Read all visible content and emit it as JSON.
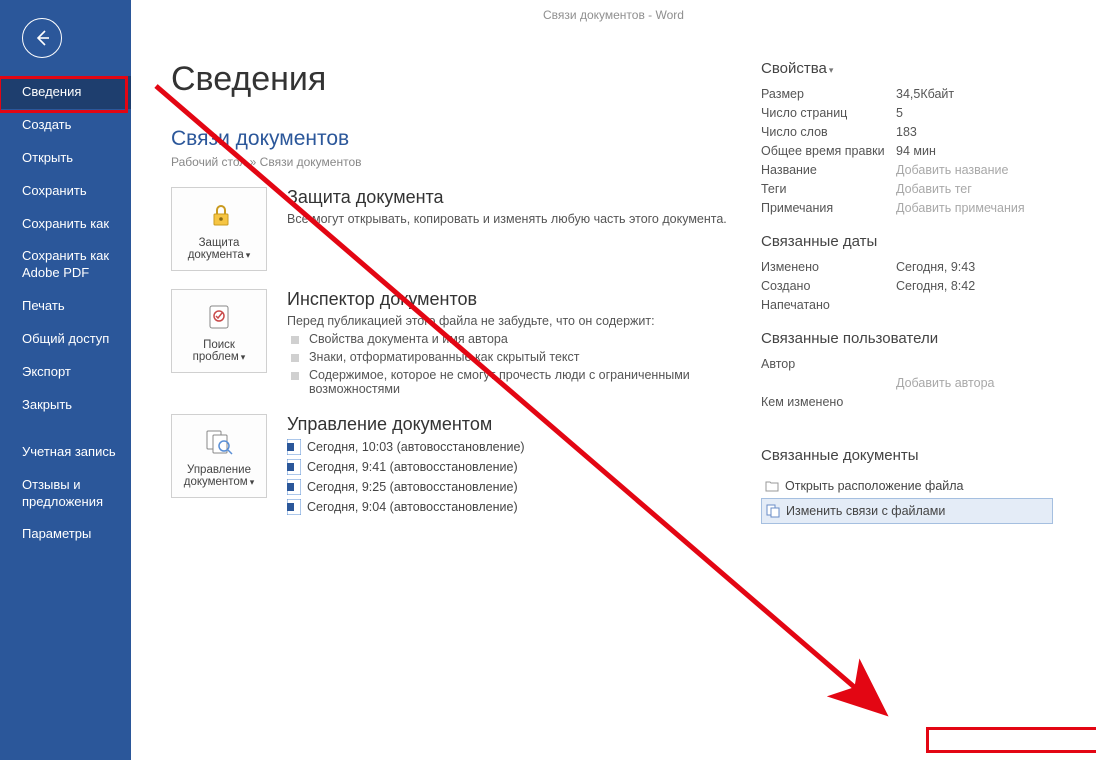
{
  "titlebar": "Связи документов  -  Word",
  "sidebar": {
    "items": [
      "Сведения",
      "Создать",
      "Открыть",
      "Сохранить",
      "Сохранить как",
      "Сохранить как Adobe PDF",
      "Печать",
      "Общий доступ",
      "Экспорт",
      "Закрыть",
      "Учетная запись",
      "Отзывы и предложения",
      "Параметры"
    ]
  },
  "page": {
    "title": "Сведения",
    "doc_title": "Связи документов",
    "breadcrumb": "Рабочий стол » Связи документов"
  },
  "protect": {
    "tile": "Защита документа",
    "heading": "Защита документа",
    "text": "Все могут открывать, копировать и изменять любую часть этого документа."
  },
  "inspect": {
    "tile": "Поиск проблем",
    "heading": "Инспектор документов",
    "intro": "Перед публикацией этого файла не забудьте, что он содержит:",
    "bullets": [
      "Свойства документа и имя автора",
      "Знаки, отформатированные как скрытый текст",
      "Содержимое, которое не смогут прочесть люди с ограниченными возможностями"
    ]
  },
  "manage": {
    "tile": "Управление документом",
    "heading": "Управление документом",
    "entries": [
      "Сегодня, 10:03 (автовосстановление)",
      "Сегодня, 9:41 (автовосстановление)",
      "Сегодня, 9:25 (автовосстановление)",
      "Сегодня, 9:04 (автовосстановление)"
    ]
  },
  "props": {
    "heading": "Свойства",
    "rows": [
      {
        "k": "Размер",
        "v": "34,5Кбайт"
      },
      {
        "k": "Число страниц",
        "v": "5"
      },
      {
        "k": "Число слов",
        "v": "183"
      },
      {
        "k": "Общее время правки",
        "v": "94 мин"
      },
      {
        "k": "Название",
        "v": "Добавить название",
        "muted": true
      },
      {
        "k": "Теги",
        "v": "Добавить тег",
        "muted": true
      },
      {
        "k": "Примечания",
        "v": "Добавить примечания",
        "muted": true
      }
    ]
  },
  "dates": {
    "heading": "Связанные даты",
    "rows": [
      {
        "k": "Изменено",
        "v": "Сегодня, 9:43"
      },
      {
        "k": "Создано",
        "v": "Сегодня, 8:42"
      },
      {
        "k": "Напечатано",
        "v": ""
      }
    ]
  },
  "users": {
    "heading": "Связанные пользователи",
    "author_k": "Автор",
    "author_add": "Добавить автора",
    "modified_k": "Кем изменено"
  },
  "linked": {
    "heading": "Связанные документы",
    "open": "Открыть расположение файла",
    "edit": "Изменить связи с файлами"
  }
}
